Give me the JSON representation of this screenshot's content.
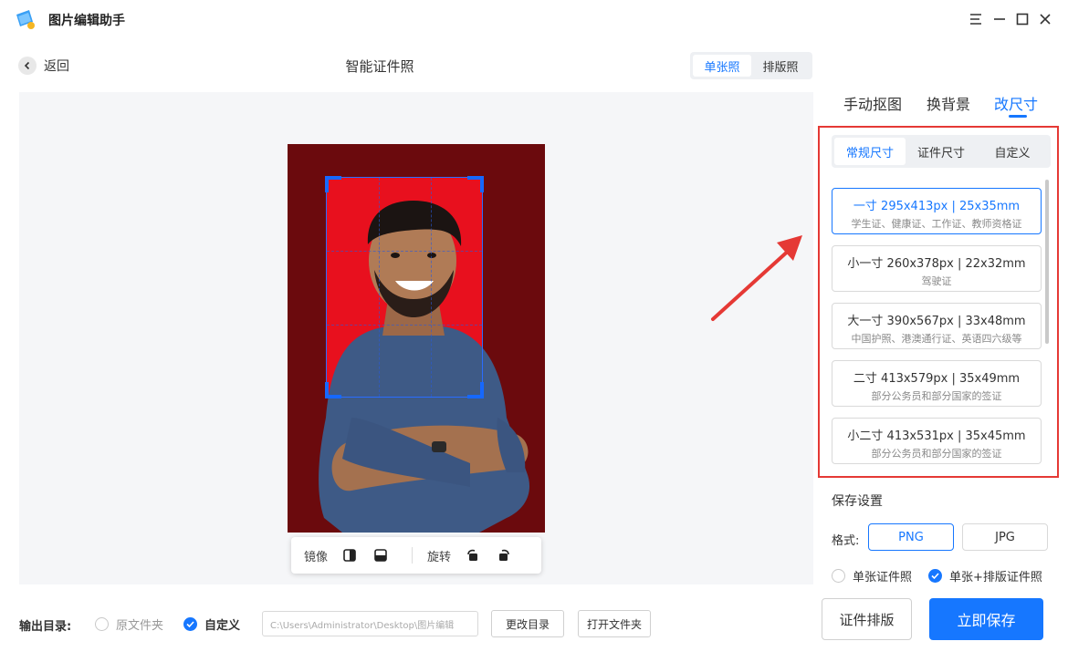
{
  "app": {
    "title": "图片编辑助手"
  },
  "header": {
    "back_label": "返回",
    "page_title": "智能证件照",
    "modes": [
      "单张照",
      "排版照"
    ],
    "active_mode": 0
  },
  "photo_toolbar": {
    "mirror_label": "镜像",
    "rotate_label": "旋转"
  },
  "right_panel": {
    "tabs": [
      "手动抠图",
      "换背景",
      "改尺寸"
    ],
    "active_tab": 2,
    "subtabs": [
      "常规尺寸",
      "证件尺寸",
      "自定义"
    ],
    "active_subtab": 0,
    "sizes": [
      {
        "name": "一寸 295x413px | 25x35mm",
        "desc": "学生证、健康证、工作证、教师资格证"
      },
      {
        "name": "小一寸 260x378px | 22x32mm",
        "desc": "驾驶证"
      },
      {
        "name": "大一寸 390x567px | 33x48mm",
        "desc": "中国护照、港澳通行证、英语四六级等"
      },
      {
        "name": "二寸 413x579px | 35x49mm",
        "desc": "部分公务员和部分国家的签证"
      },
      {
        "name": "小二寸 413x531px | 35x45mm",
        "desc": "部分公务员和部分国家的签证"
      }
    ],
    "active_size": 0
  },
  "save_settings": {
    "title": "保存设置",
    "format_label": "格式:",
    "formats": [
      "PNG",
      "JPG"
    ],
    "active_format": "PNG",
    "output_options": [
      "单张证件照",
      "单张+排版证件照"
    ],
    "selected_output": 1,
    "layout_button": "证件排版",
    "save_button": "立即保存"
  },
  "output_dir": {
    "label": "输出目录:",
    "options": [
      "原文件夹",
      "自定义"
    ],
    "selected": 1,
    "path": "C:\\Users\\Administrator\\Desktop\\图片编辑",
    "change_button": "更改目录",
    "open_button": "打开文件夹"
  },
  "colors": {
    "accent": "#1677ff",
    "photo_bg": "#6b0a0d",
    "crop_bg": "#e8101e",
    "highlight_border": "#e53935"
  }
}
